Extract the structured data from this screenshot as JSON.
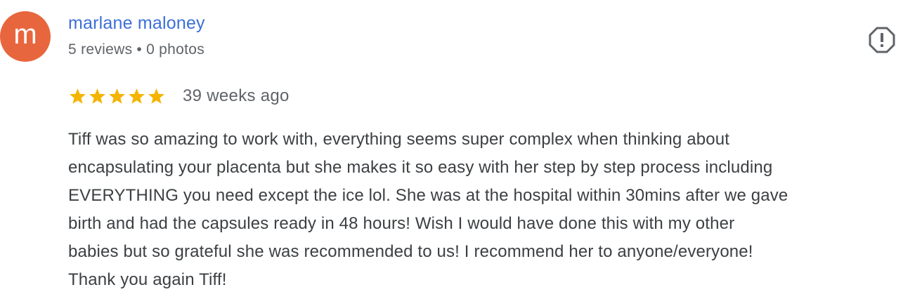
{
  "reviewer": {
    "avatar_letter": "m",
    "avatar_color": "#e8663d",
    "name": "marlane maloney",
    "reviews_count": "5 reviews",
    "separator": "•",
    "photos_count": "0 photos"
  },
  "flag": {
    "icon": "report-flag-icon"
  },
  "rating": {
    "stars": 5,
    "max_stars": 5,
    "star_color": "#f4b400",
    "date": "39 weeks ago"
  },
  "review": {
    "text": "Tiff was so amazing to work with, everything seems super complex when thinking about\nencapsulating your placenta but she makes it so easy with her step by step process including\nEVERYTHING you need except the ice lol. She was at the hospital within 30mins after we gave\nbirth and had the capsules ready in 48 hours! Wish I would have done this with my other\nbabies but so grateful she was recommended to us! I recommend her to anyone/everyone!\nThank you again Tiff!"
  }
}
